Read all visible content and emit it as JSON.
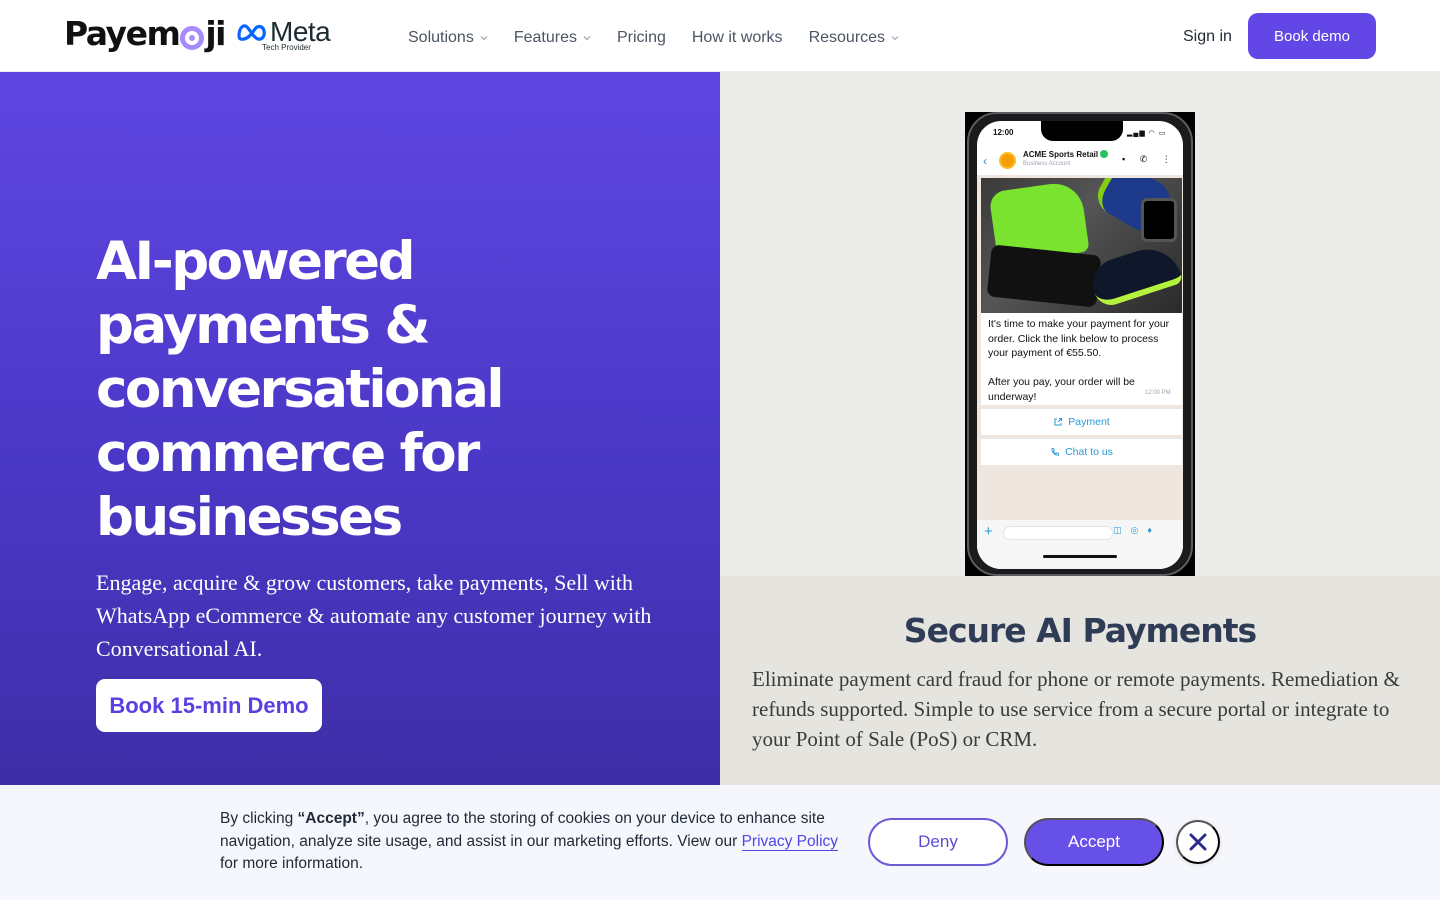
{
  "header": {
    "logo_text_pre": "Payem",
    "logo_text_post": "ji",
    "partner_word": "Meta",
    "partner_sub": "Tech Provider",
    "nav": [
      {
        "label": "Solutions",
        "has_dropdown": true
      },
      {
        "label": "Features",
        "has_dropdown": true
      },
      {
        "label": "Pricing",
        "has_dropdown": false
      },
      {
        "label": "How it works",
        "has_dropdown": false
      },
      {
        "label": "Resources",
        "has_dropdown": true
      }
    ],
    "sign_in": "Sign in",
    "book_demo": "Book demo"
  },
  "hero": {
    "title": "AI-powered payments & conversational commerce for businesses",
    "subtitle": "Engage, acquire & grow customers, take payments, Sell with WhatsApp eCommerce & automate any customer journey with Conversational AI.",
    "cta": "Book 15-min Demo"
  },
  "phone": {
    "time": "12:00",
    "business_name": "ACME Sports Retail",
    "business_sub": "Business Account",
    "message_line1": "It's time to make your payment for your order. Click the link below to process your payment of €55.50.",
    "message_line2": "After you pay, your order will be underway!",
    "message_time": "12:00 PM",
    "button_payment": "Payment",
    "button_chat": "Chat to us"
  },
  "feature_card": {
    "title": "Secure AI Payments",
    "text": "Eliminate payment card fraud for phone or remote payments. Remediation & refunds supported. Simple to use service from a secure portal or integrate to your Point of Sale (PoS) or CRM."
  },
  "cookie": {
    "text_before": "By clicking ",
    "text_bold": "“Accept”",
    "text_after": ", you agree to the storing of cookies on your device to enhance site navigation, analyze site usage, and assist in our marketing efforts. View our ",
    "privacy_link": "Privacy Policy",
    "text_end": " for more information.",
    "deny": "Deny",
    "accept": "Accept"
  },
  "colors": {
    "brand_purple": "#6347e6",
    "hero_gradient_top": "#5f46e2",
    "hero_gradient_bottom": "#3f2ea7",
    "card_bg": "#e5e4df",
    "cookie_bg": "#f5f7fc"
  },
  "icons": [
    "meta-logo-icon",
    "chevron-down-icon",
    "close-icon",
    "external-link-icon",
    "phone-icon"
  ]
}
